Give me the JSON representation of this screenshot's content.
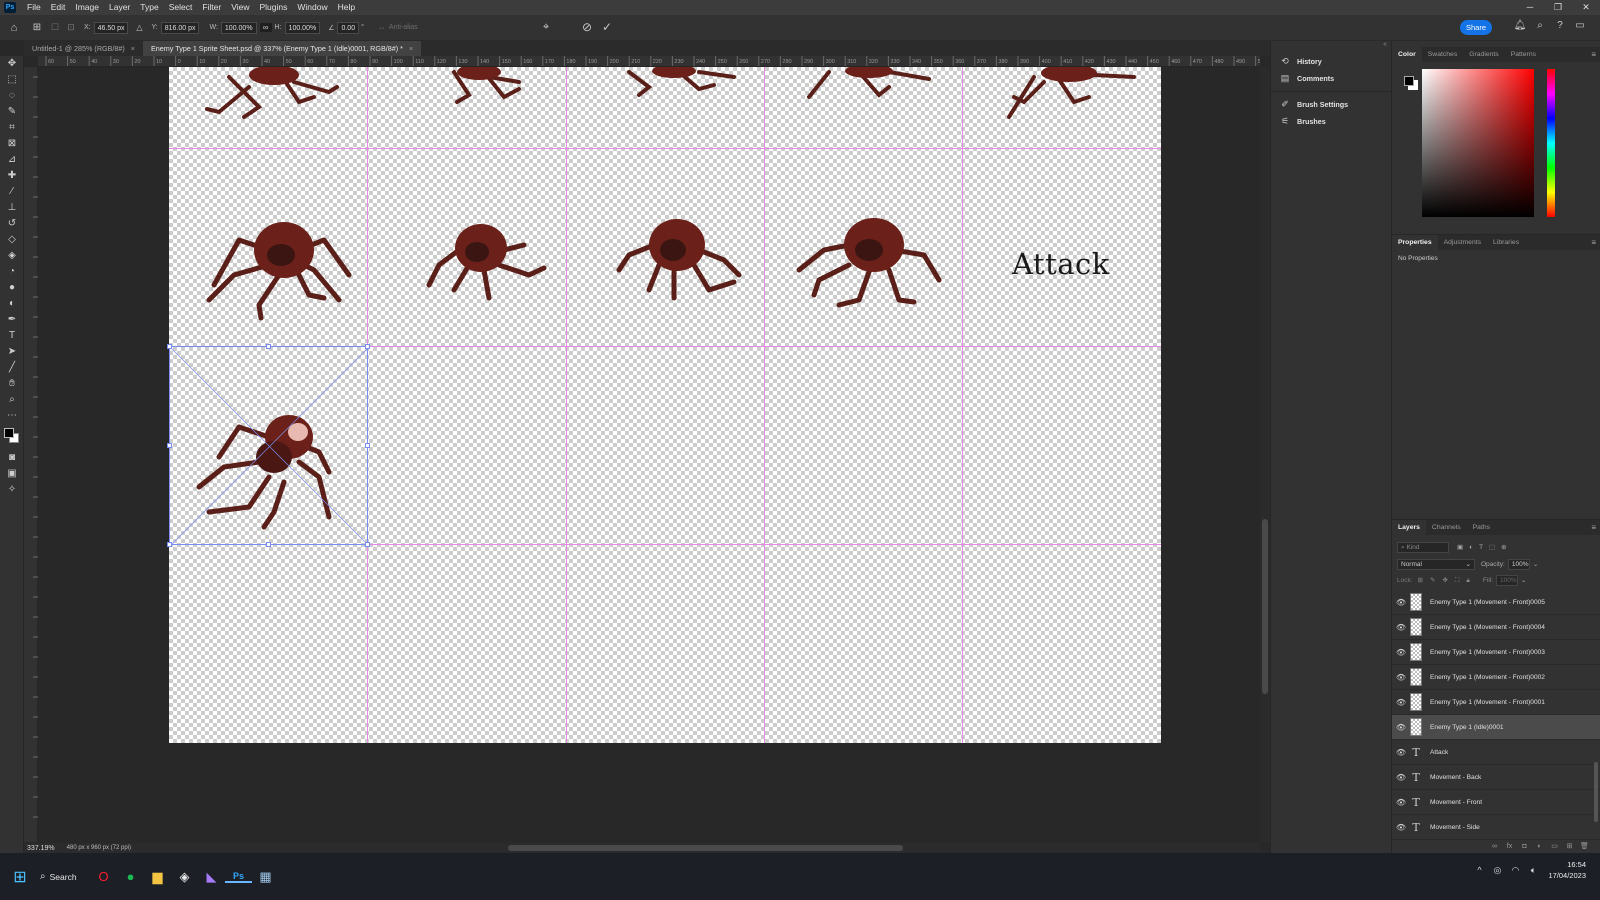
{
  "menubar": {
    "logo": "Ps",
    "items": [
      "File",
      "Edit",
      "Image",
      "Layer",
      "Type",
      "Select",
      "Filter",
      "View",
      "Plugins",
      "Window",
      "Help"
    ]
  },
  "options": {
    "x_label": "X:",
    "x_value": "46.50 px",
    "y_label": "Y:",
    "y_value": "816.00 px",
    "w_label": "W:",
    "w_value": "100.00%",
    "h_label": "H:",
    "h_value": "100.00%",
    "angle_value": "0.00",
    "antialias": "Anti-alias",
    "share": "Share"
  },
  "tabs": [
    {
      "label": "Untitled-1 @ 285% (RGB/8#)",
      "active": false
    },
    {
      "label": "Enemy Type 1 Sprite Sheet.psd @ 337% (Enemy Type 1 (Idle)0001, RGB/8#) *",
      "active": true
    }
  ],
  "ruler_ticks": [
    "60",
    "50",
    "40",
    "30",
    "20",
    "10",
    "0",
    "10",
    "20",
    "30",
    "40",
    "50",
    "60",
    "70",
    "80",
    "90",
    "100",
    "110",
    "120",
    "130",
    "140",
    "150",
    "160",
    "170",
    "180",
    "190",
    "200",
    "210",
    "220",
    "230",
    "240",
    "250",
    "260",
    "270",
    "280",
    "290",
    "300",
    "310",
    "320",
    "330",
    "340",
    "350",
    "360",
    "370",
    "380",
    "390",
    "400",
    "410",
    "420",
    "430",
    "440",
    "450",
    "460",
    "470",
    "480",
    "490",
    "500"
  ],
  "canvas": {
    "attack_label": "Attack"
  },
  "status": {
    "zoom": "337.19%",
    "doc_size": "480 px x 960 px (72 ppi)"
  },
  "midpanel": {
    "items": [
      {
        "label": "History",
        "icon": "history-icon"
      },
      {
        "label": "Comments",
        "icon": "comments-icon"
      },
      {
        "label": "Brush Settings",
        "icon": "brush-settings-icon"
      },
      {
        "label": "Brushes",
        "icon": "brushes-icon"
      }
    ]
  },
  "color_panel": {
    "tabs": [
      "Color",
      "Swatches",
      "Gradients",
      "Patterns"
    ],
    "fg": "#000000",
    "bg": "#ffffff"
  },
  "properties_panel": {
    "tabs": [
      "Properties",
      "Adjustments",
      "Libraries"
    ],
    "content": "No Properties"
  },
  "layers_panel": {
    "tabs": [
      "Layers",
      "Channels",
      "Paths"
    ],
    "filter_placeholder": "Kind",
    "blend_mode": "Normal",
    "opacity_label": "Opacity:",
    "opacity": "100%",
    "lock_label": "Lock:",
    "fill_label": "Fill:",
    "fill": "100%",
    "layers": [
      {
        "name": "Enemy Type 1 (Movement - Front)0005",
        "kind": "image",
        "selected": false
      },
      {
        "name": "Enemy Type 1 (Movement - Front)0004",
        "kind": "image",
        "selected": false
      },
      {
        "name": "Enemy Type 1 (Movement - Front)0003",
        "kind": "image",
        "selected": false
      },
      {
        "name": "Enemy Type 1 (Movement - Front)0002",
        "kind": "image",
        "selected": false
      },
      {
        "name": "Enemy Type 1 (Movement - Front)0001",
        "kind": "image",
        "selected": false
      },
      {
        "name": "Enemy Type 1 (Idle)0001",
        "kind": "image",
        "selected": true
      },
      {
        "name": "Attack",
        "kind": "text",
        "selected": false
      },
      {
        "name": "Movement - Back",
        "kind": "text",
        "selected": false
      },
      {
        "name": "Movement - Front",
        "kind": "text",
        "selected": false
      },
      {
        "name": "Movement - Side",
        "kind": "text",
        "selected": false
      }
    ]
  },
  "taskbar": {
    "search": "Search",
    "apps": [
      {
        "name": "opera-app",
        "glyph": "O",
        "color": "#ff1b2d"
      },
      {
        "name": "spotify-app",
        "glyph": "●",
        "color": "#1db954"
      },
      {
        "name": "file-explorer-app",
        "glyph": "▆",
        "color": "#f4c542"
      },
      {
        "name": "unity-app",
        "glyph": "◈",
        "color": "#e6e6e6"
      },
      {
        "name": "visual-studio-app",
        "glyph": "◣",
        "color": "#a67bf5"
      },
      {
        "name": "photoshop-app",
        "glyph": "Ps",
        "color": "#31a8ff"
      },
      {
        "name": "calculator-app",
        "glyph": "▦",
        "color": "#9ec5e8"
      }
    ],
    "time": "16:54",
    "date": "17/04/2023"
  },
  "colors": {
    "accent": "#1473e6",
    "guide": "#e58ae5",
    "selection": "#7a8cf2",
    "sprite": "#6b2019"
  }
}
